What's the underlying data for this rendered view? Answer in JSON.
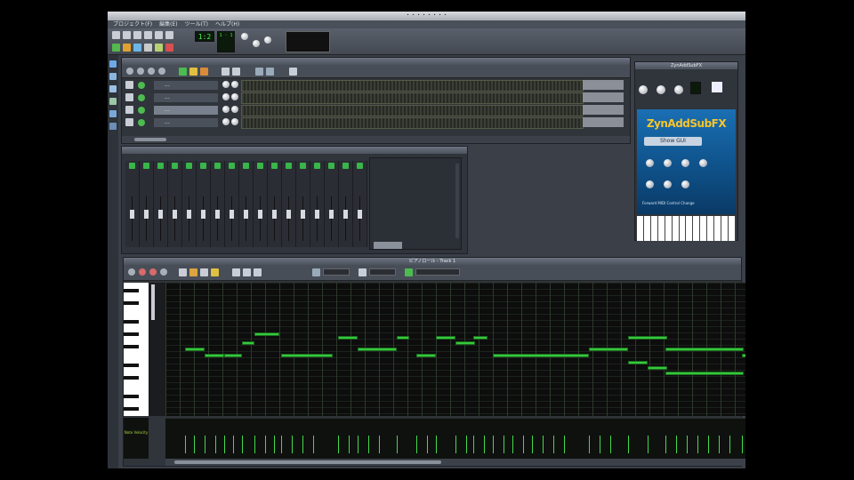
{
  "app": {
    "title": "・・・・・・・・",
    "menus": [
      "プロジェクト(F)",
      "編集(E)",
      "ツール(T)",
      "ヘルプ(H)"
    ]
  },
  "toolbar": {
    "time_display": "1:2",
    "cpu_display": "1 · 1"
  },
  "song_editor": {
    "tracks": [
      {
        "name": "...",
        "selected": false
      },
      {
        "name": "...",
        "selected": false
      },
      {
        "name": "...",
        "selected": true
      },
      {
        "name": "...",
        "selected": false
      }
    ]
  },
  "fx_mixer": {
    "channel_count": 17
  },
  "zyn": {
    "window_title": "ZynAddSubFX",
    "logo": "ZynAddSubFX",
    "button_label": "Show GUI",
    "footer": "Forward MIDI Control Change"
  },
  "piano_roll": {
    "title": "ピアノロール - Track 1",
    "velocity_label": "Note Velocity",
    "notes_grid_colors": {
      "note": "#34c93c",
      "background": "#0d0d0d"
    }
  },
  "colors": {
    "accent_green": "#34c93c",
    "zyn_blue": "#1a6fb3",
    "zyn_logo": "#f6c52d"
  }
}
